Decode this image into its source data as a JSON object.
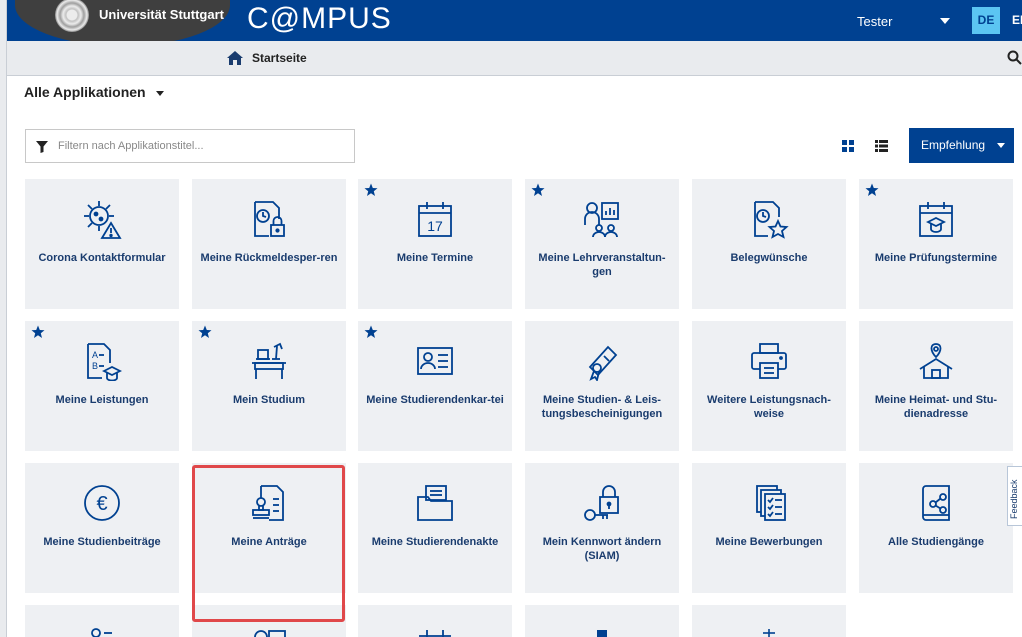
{
  "header": {
    "university": "Universität Stuttgart",
    "app_name": "C@MPUS",
    "user": "Tester",
    "lang_active": "DE",
    "lang_other": "EN"
  },
  "breadcrumb": {
    "home": "Startseite"
  },
  "section": {
    "title": "Alle Applikationen"
  },
  "filter": {
    "placeholder": "Filtern nach Applikationstitel..."
  },
  "sort": {
    "label": "Empfehlung"
  },
  "tiles": [
    {
      "label": "Corona Kontaktformular",
      "icon": "virus-warning-icon",
      "favorite": false
    },
    {
      "label": "Meine Rückmeldesper-ren",
      "icon": "document-lock-icon",
      "favorite": false
    },
    {
      "label": "Meine Termine",
      "icon": "calendar-17-icon",
      "favorite": true
    },
    {
      "label": "Meine Lehrveranstaltun-gen",
      "icon": "lecturer-icon",
      "favorite": true
    },
    {
      "label": "Belegwünsche",
      "icon": "document-star-icon",
      "favorite": false
    },
    {
      "label": "Meine Prüfungstermine",
      "icon": "calendar-graduation-icon",
      "favorite": true
    },
    {
      "label": "Meine Leistungen",
      "icon": "grades-document-icon",
      "favorite": true
    },
    {
      "label": "Mein Studium",
      "icon": "study-desk-icon",
      "favorite": true
    },
    {
      "label": "Meine Studierendenkar-tei",
      "icon": "id-card-icon",
      "favorite": true
    },
    {
      "label": "Meine Studien- & Leis-tungsbescheinigungen",
      "icon": "certificate-scroll-icon",
      "favorite": false
    },
    {
      "label": "Weitere Leistungsnach-weise",
      "icon": "printer-icon",
      "favorite": false
    },
    {
      "label": "Meine Heimat- und Stu-dienadresse",
      "icon": "home-location-icon",
      "favorite": false
    },
    {
      "label": "Meine Studienbeiträge",
      "icon": "euro-icon",
      "favorite": false
    },
    {
      "label": "Meine Anträge",
      "icon": "application-stamp-icon",
      "favorite": false
    },
    {
      "label": "Meine Studierendenakte",
      "icon": "folder-documents-icon",
      "favorite": false
    },
    {
      "label": "Mein Kennwort ändern (SIAM)",
      "icon": "key-lock-icon",
      "favorite": false
    },
    {
      "label": "Meine Bewerbungen",
      "icon": "application-documents-icon",
      "favorite": false
    },
    {
      "label": "Alle Studiengänge",
      "icon": "book-network-icon",
      "favorite": false
    }
  ],
  "feedback": {
    "label": "Feedback"
  },
  "colors": {
    "primary": "#004191",
    "tile_bg": "#eef0f3",
    "accent": "#5bc5f2",
    "highlight": "#e0484a"
  }
}
